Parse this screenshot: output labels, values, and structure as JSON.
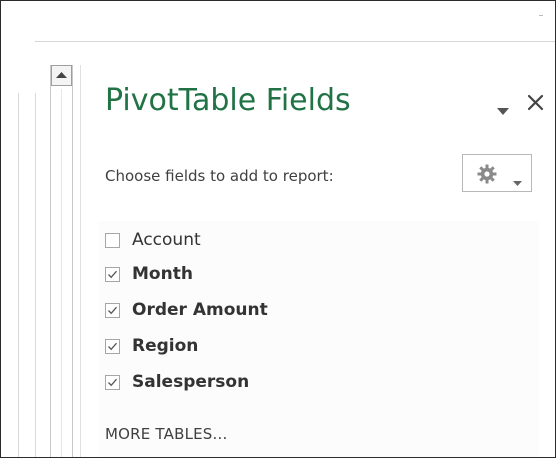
{
  "pane": {
    "title": "PivotTable Fields",
    "subtitle": "Choose fields to add to report:",
    "more_tables_label": "MORE TABLES...",
    "accent_color": "#217346"
  },
  "title_controls": {
    "dropdown_icon": "chevron-down-icon",
    "close_icon": "close-icon"
  },
  "tools_button": {
    "icon": "gear-icon",
    "caret_icon": "chevron-down-icon"
  },
  "fields": [
    {
      "label": "Account",
      "checked": false,
      "bold": false
    },
    {
      "label": "Month",
      "checked": true,
      "bold": true
    },
    {
      "label": "Order Amount",
      "checked": true,
      "bold": true
    },
    {
      "label": "Region",
      "checked": true,
      "bold": true
    },
    {
      "label": "Salesperson",
      "checked": true,
      "bold": true
    }
  ]
}
